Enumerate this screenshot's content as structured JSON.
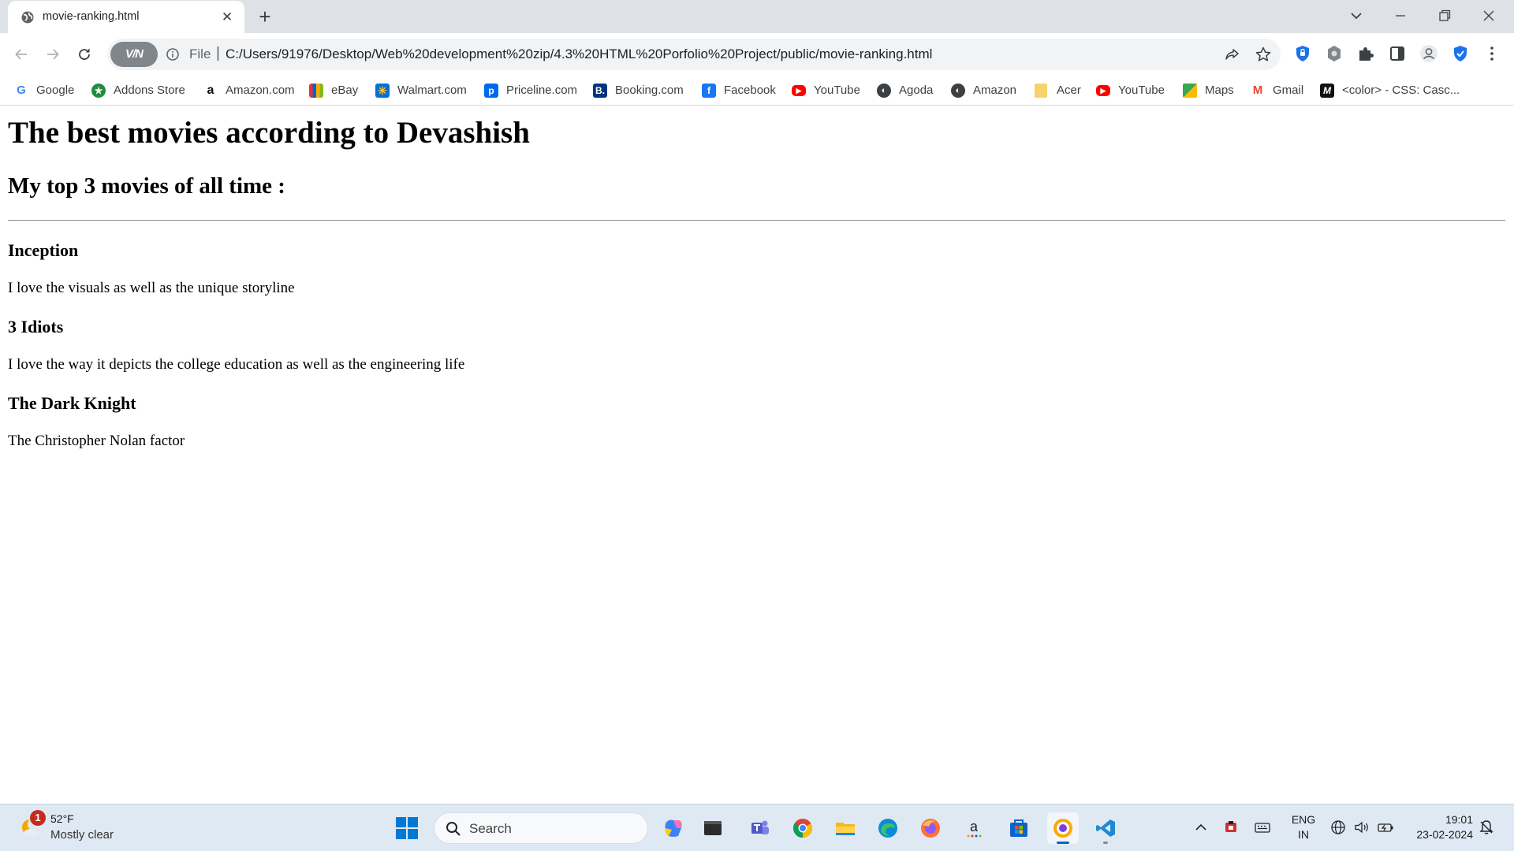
{
  "browser": {
    "tab": {
      "title": "movie-ranking.html"
    },
    "new_tab_label": "+",
    "address": {
      "vpn_label": "V/N",
      "scheme": "File",
      "url": "C:/Users/91976/Desktop/Web%20development%20zip/4.3%20HTML%20Porfolio%20Project/public/movie-ranking.html"
    },
    "bookmarks": [
      {
        "label": "Google",
        "icon": "google-icon",
        "color": "#4285f4"
      },
      {
        "label": "Addons Store",
        "icon": "addons-store-icon",
        "color": "#1e8e3e"
      },
      {
        "label": "Amazon.com",
        "icon": "amazon-icon",
        "color": "#111111"
      },
      {
        "label": "eBay",
        "icon": "ebay-icon",
        "color": "#e53238"
      },
      {
        "label": "Walmart.com",
        "icon": "walmart-icon",
        "color": "#0071dc"
      },
      {
        "label": "Priceline.com",
        "icon": "priceline-icon",
        "color": "#0068ef"
      },
      {
        "label": "Booking.com",
        "icon": "booking-icon",
        "color": "#003580"
      },
      {
        "label": "Facebook",
        "icon": "facebook-icon",
        "color": "#1877f2"
      },
      {
        "label": "YouTube",
        "icon": "youtube-icon",
        "color": "#ff0000"
      },
      {
        "label": "Agoda",
        "icon": "globe-icon",
        "color": "#3c4043"
      },
      {
        "label": "Amazon",
        "icon": "globe-icon",
        "color": "#3c4043"
      },
      {
        "label": "Acer",
        "icon": "folder-icon",
        "color": "#f6d46b"
      },
      {
        "label": "YouTube",
        "icon": "youtube-icon",
        "color": "#ff0000"
      },
      {
        "label": "Maps",
        "icon": "maps-icon",
        "color": "#34a853"
      },
      {
        "label": "Gmail",
        "icon": "gmail-icon",
        "color": "#ea4335"
      },
      {
        "label": "<color> - CSS: Casc...",
        "icon": "mdn-icon",
        "color": "#111111"
      }
    ]
  },
  "page": {
    "title": "The best movies according to Devashish",
    "subtitle": "My top 3 movies of all time :",
    "movies": [
      {
        "name": "Inception",
        "reason": "I love the visuals as well as the unique storyline"
      },
      {
        "name": "3 Idiots",
        "reason": "I love the way it depicts the college education as well as the engineering life"
      },
      {
        "name": "The Dark Knight",
        "reason": "The Christopher Nolan factor"
      }
    ]
  },
  "taskbar": {
    "weather": {
      "badge": "1",
      "temp": "52°F",
      "condition": "Mostly clear"
    },
    "search_label": "Search",
    "lang_primary": "ENG",
    "lang_secondary": "IN",
    "time": "19:01",
    "date": "23-02-2024"
  }
}
